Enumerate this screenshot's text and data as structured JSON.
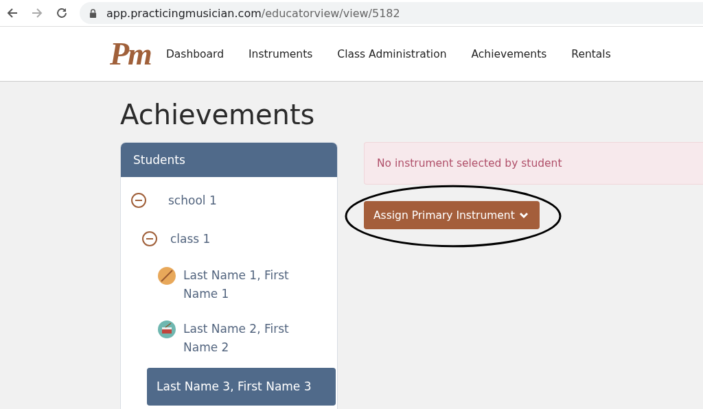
{
  "browser": {
    "url_host": "app.practicingmusician.com",
    "url_path": "/educatorview/view/5182"
  },
  "nav": {
    "logo": "Pm",
    "links": [
      {
        "label": "Dashboard"
      },
      {
        "label": "Instruments"
      },
      {
        "label": "Class Administration"
      },
      {
        "label": "Achievements"
      },
      {
        "label": "Rentals"
      }
    ]
  },
  "page_title": "Achievements",
  "students_panel": {
    "title": "Students",
    "tree": [
      {
        "label": "school 1",
        "kind": "group",
        "expanded": true,
        "children": [
          {
            "label": "class 1",
            "kind": "group",
            "expanded": true,
            "children": [
              {
                "label": "Last Name 1, First Name 1",
                "kind": "flute",
                "selected": false
              },
              {
                "label": "Last Name 2, First Name 2",
                "kind": "drum",
                "selected": false
              },
              {
                "label": "Last Name 3, First Name 3",
                "kind": "student",
                "selected": true
              }
            ]
          }
        ]
      }
    ]
  },
  "alert": {
    "text": "No instrument selected by student"
  },
  "assign_button": {
    "label": "Assign Primary Instrument",
    "circled": true
  }
}
